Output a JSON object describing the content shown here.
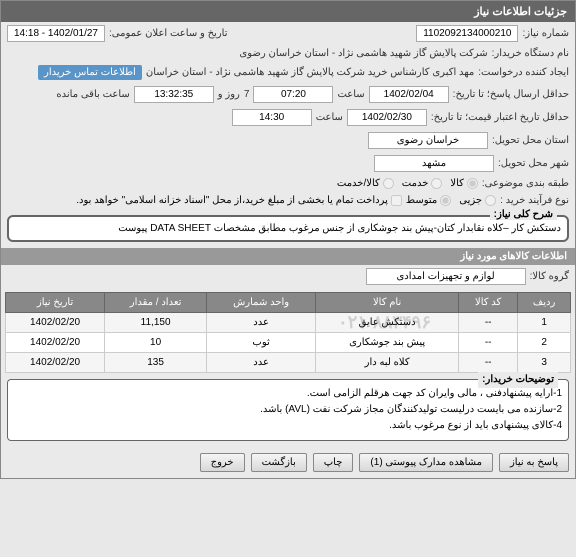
{
  "header": {
    "title": "جزئیات اطلاعات نیاز"
  },
  "fields": {
    "req_number_label": "شماره نیاز:",
    "req_number": "1102092134000210",
    "announce_label": "تاریخ و ساعت اعلان عمومی:",
    "announce_value": "1402/01/27 - 14:18",
    "buyer_label": "نام دستگاه خریدار:",
    "buyer_value": "شرکت پالایش گاز شهید هاشمی نژاد - استان خراسان رضوی",
    "creator_label": "ایجاد کننده درخواست:",
    "creator_value": "مهد اکبری کارشناس خرید شرکت پالایش گاز شهید هاشمی نژاد - استان خراسان",
    "creator_badge": "اطلاعات تماس خریدار",
    "deadline_label": "حداقل ارسال پاسخ؛ تا تاریخ:",
    "deadline_date": "1402/02/04",
    "time_label": "ساعت",
    "deadline_time": "07:20",
    "days": "7",
    "days_label": "روز و",
    "remaining_time": "13:32:35",
    "remaining_label": "ساعت باقی مانده",
    "validity_label": "حداقل تاریخ اعتبار قیمت؛ تا تاریخ:",
    "validity_date": "1402/02/30",
    "validity_time": "14:30",
    "province_label": "استان محل تحویل:",
    "province_value": "خراسان رضوی",
    "city_label": "شهر محل تحویل:",
    "city_value": "مشهد",
    "category_label": "طبقه بندی موضوعی:",
    "cat_kala": "کالا",
    "cat_khedmat": "خدمت",
    "cat_both": "کالا/خدمت",
    "process_label": "نوع فرآیند خرید :",
    "proc_small": "جزیی",
    "proc_medium": "متوسط",
    "payment_note": "پرداخت تمام یا بخشی از مبلغ خرید،از محل \"اسناد خزانه اسلامی\" خواهد بود."
  },
  "desc": {
    "label": "شرح کلی نیاز:",
    "text": "دستکش کار –کلاه نقابدار کتان-پیش بند جوشکاری از جنس مرغوب مطابق مشخصات DATA SHEET پیوست"
  },
  "items_header": "اطلاعات کالاهای مورد نیاز",
  "group_label": "گروه کالا:",
  "group_value": "لوازم و تجهیزات امدادی",
  "table": {
    "headers": [
      "ردیف",
      "کد کالا",
      "نام کالا",
      "واحد شمارش",
      "تعداد / مقدار",
      "تاریخ نیاز"
    ],
    "rows": [
      [
        "1",
        "--",
        "دستکش عایق",
        "عدد",
        "11,150",
        "1402/02/20"
      ],
      [
        "2",
        "--",
        "پیش بند جوشکاری",
        "ثوب",
        "10",
        "1402/02/20"
      ],
      [
        "3",
        "--",
        "کلاه لبه دار",
        "عدد",
        "135",
        "1402/02/20"
      ]
    ],
    "watermark": "۰۲۱-۸۸۳۴۹۶"
  },
  "notes": {
    "label": "توضیحات خریدار:",
    "lines": [
      "1-ارايه پيشنهادفنی ، مالی وايران كد جهت هرقلم الزامی است.",
      "2-سازنده می بايست درليست توليدكنندگان مجاز شركت نفت (AVL) باشد.",
      "4-کالای پیشنهادی باید از نوع مرغوب باشد."
    ]
  },
  "buttons": {
    "reply": "پاسخ به نیاز",
    "attachments": "مشاهده مدارک پیوستی (1)",
    "print": "چاپ",
    "back": "بازگشت",
    "exit": "خروج"
  }
}
